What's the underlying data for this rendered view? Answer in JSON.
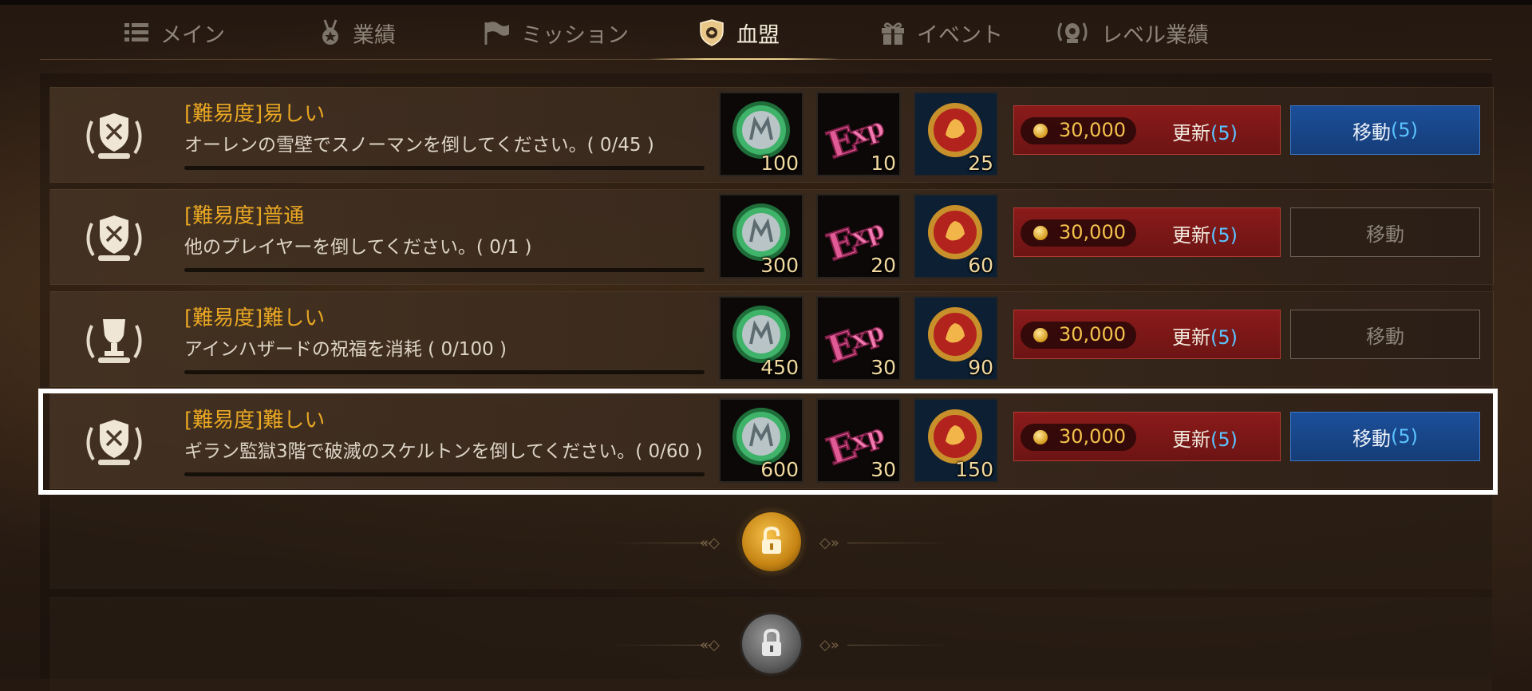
{
  "tabs": [
    {
      "label": "メイン",
      "icon": "list-icon",
      "active": false
    },
    {
      "label": "業績",
      "icon": "medal-icon",
      "active": false
    },
    {
      "label": "ミッション",
      "icon": "flag-icon",
      "active": false
    },
    {
      "label": "血盟",
      "icon": "clan-shield-icon",
      "active": true
    },
    {
      "label": "イベント",
      "icon": "gift-icon",
      "active": false
    },
    {
      "label": "レベル業績",
      "icon": "laurel-icon",
      "active": false
    }
  ],
  "colors": {
    "difficulty": "#e8a623",
    "count": "#5cc3ff",
    "refresh_bg": "#7a1817",
    "move_active_bg": "#1c4f9a",
    "highlight": "#ffffff"
  },
  "missions": [
    {
      "emblem": "shield-laurel-icon",
      "difficulty": "[難易度]易しい",
      "description": "オーレンの雪壁でスノーマンを倒してください。( 0/45 )",
      "progress": 0,
      "rewards": [
        {
          "icon": "m-coin-icon",
          "amount": "100"
        },
        {
          "icon": "exp-icon",
          "amount": "10"
        },
        {
          "icon": "lion-medal-icon",
          "amount": "25"
        }
      ],
      "refresh_cost": "30,000",
      "refresh_label": "更新",
      "refresh_count": "(5)",
      "move_label": "移動",
      "move_count": "(5)",
      "move_enabled": true
    },
    {
      "emblem": "shield-laurel-icon",
      "difficulty": "[難易度]普通",
      "description": "他のプレイヤーを倒してください。( 0/1 )",
      "progress": 0,
      "rewards": [
        {
          "icon": "m-coin-icon",
          "amount": "300"
        },
        {
          "icon": "exp-icon",
          "amount": "20"
        },
        {
          "icon": "lion-medal-icon",
          "amount": "60"
        }
      ],
      "refresh_cost": "30,000",
      "refresh_label": "更新",
      "refresh_count": "(5)",
      "move_label": "移動",
      "move_count": "",
      "move_enabled": false
    },
    {
      "emblem": "trophy-laurel-icon",
      "difficulty": "[難易度]難しい",
      "description": "アインハザードの祝福を消耗 ( 0/100 )",
      "progress": 0,
      "rewards": [
        {
          "icon": "m-coin-icon",
          "amount": "450"
        },
        {
          "icon": "exp-icon",
          "amount": "30"
        },
        {
          "icon": "lion-medal-icon",
          "amount": "90"
        }
      ],
      "refresh_cost": "30,000",
      "refresh_label": "更新",
      "refresh_count": "(5)",
      "move_label": "移動",
      "move_count": "",
      "move_enabled": false
    },
    {
      "emblem": "shield-laurel-icon",
      "difficulty": "[難易度]難しい",
      "description": "ギラン監獄3階で破滅のスケルトンを倒してください。( 0/60 )",
      "progress": 0,
      "rewards": [
        {
          "icon": "m-coin-icon",
          "amount": "600"
        },
        {
          "icon": "exp-icon",
          "amount": "30"
        },
        {
          "icon": "lion-medal-icon",
          "amount": "150"
        }
      ],
      "refresh_cost": "30,000",
      "refresh_label": "更新",
      "refresh_count": "(5)",
      "move_label": "移動",
      "move_count": "(5)",
      "move_enabled": true
    }
  ],
  "locked_slots": [
    {
      "icon": "lock-icon",
      "style": "gold"
    },
    {
      "icon": "lock-icon",
      "style": "grey"
    }
  ]
}
